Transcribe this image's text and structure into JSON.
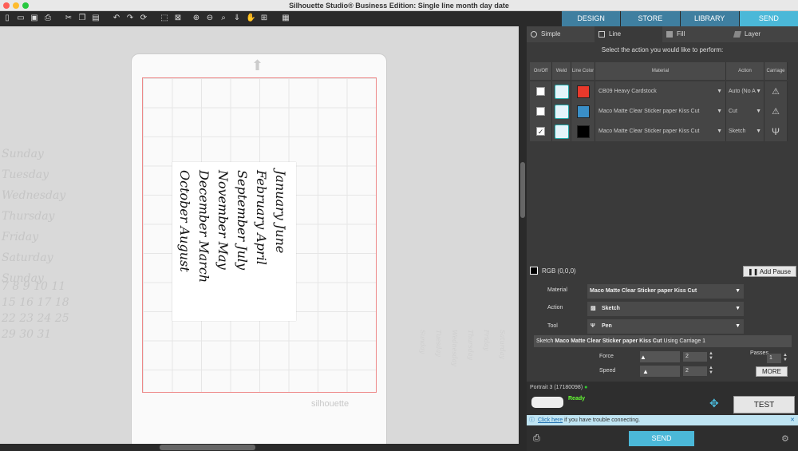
{
  "app": {
    "title": "Silhouette Studio® Business Edition: Single line month day date"
  },
  "top_tabs": [
    {
      "label": "DESIGN",
      "active": false
    },
    {
      "label": "STORE",
      "active": false
    },
    {
      "label": "LIBRARY",
      "active": false
    },
    {
      "label": "SEND",
      "active": true
    }
  ],
  "send_tabs": [
    {
      "label": "Simple",
      "active": false
    },
    {
      "label": "Line",
      "active": true
    },
    {
      "label": "Fill",
      "active": false
    },
    {
      "label": "Layer",
      "active": false
    }
  ],
  "prompt": "Select the action you would like to perform:",
  "table": {
    "headers": [
      "On/Off",
      "Weld",
      "Line Color",
      "Material",
      "Action",
      "Carriage"
    ],
    "rows": [
      {
        "checked": false,
        "color": "#e8392b",
        "material": "CB09 Heavy Cardstock",
        "action": "Auto (No A"
      },
      {
        "checked": false,
        "color": "#3a8fc8",
        "material": "Maco Matte Clear Sticker paper Kiss Cut",
        "action": "Cut"
      },
      {
        "checked": true,
        "check_mark": "✓",
        "color": "#000000",
        "material": "Maco Matte Clear Sticker paper Kiss Cut",
        "action": "Sketch"
      }
    ]
  },
  "rgb_label": "RGB (0,0,0)",
  "add_pause": "Add Pause",
  "settings": {
    "material_label": "Material",
    "material_value": "Maco Matte Clear Sticker paper Kiss Cut",
    "action_label": "Action",
    "action_value": "Sketch",
    "tool_label": "Tool",
    "tool_value": "Pen",
    "summary_prefix": "Sketch ",
    "summary_material": "Maco Matte Clear Sticker paper Kiss Cut",
    "summary_suffix": " Using Carriage 1",
    "force_label": "Force",
    "force_value": "2",
    "speed_label": "Speed",
    "speed_value": "2",
    "passes_label": "Passes",
    "passes_value": "1",
    "more": "MORE"
  },
  "device": {
    "name": "Portrait 3 (17180098)",
    "status": "Ready",
    "test": "TEST"
  },
  "notice": {
    "link": "Click here",
    "text": " if you have trouble connecting."
  },
  "send_label": "SEND",
  "canvas": {
    "watermark": "silhouette",
    "months": [
      {
        "text": "January June"
      },
      {
        "text": "February April"
      },
      {
        "text": "September July"
      },
      {
        "text": "November May"
      },
      {
        "text": "December March"
      },
      {
        "text": "October August"
      }
    ],
    "ghost_left": [
      "Sunday",
      "Tuesday",
      "Wednesday",
      "Thursday",
      "Friday",
      "Saturday",
      "Sunday"
    ],
    "ghost_numbers": [
      "15 16 17 18",
      "22 23 24 25",
      "29 30 31",
      "7 8 9 10 11"
    ]
  }
}
